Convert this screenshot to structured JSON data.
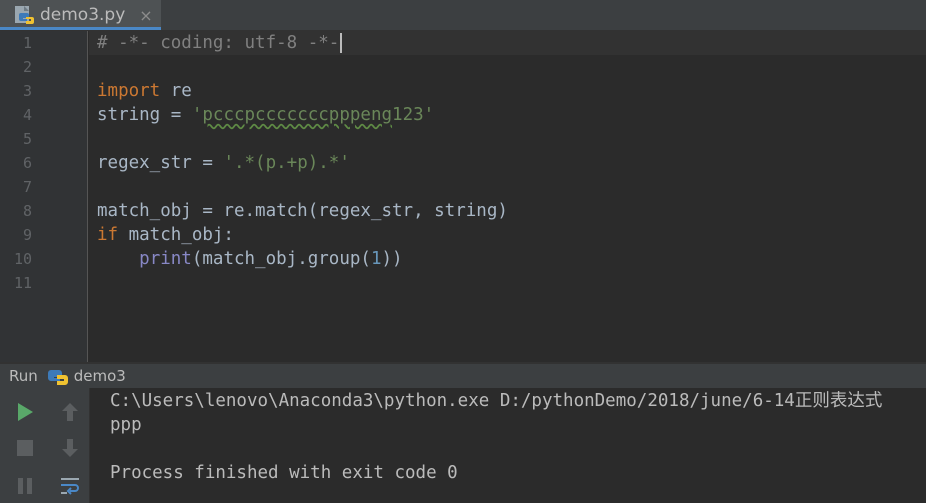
{
  "tab": {
    "filename": "demo3.py",
    "close_glyph": "×"
  },
  "editor": {
    "line_numbers": [
      "1",
      "2",
      "3",
      "4",
      "5",
      "6",
      "7",
      "8",
      "9",
      "10",
      "11"
    ],
    "l1_comment": "# -*- coding: utf-8 -*-",
    "l3_kw": "import",
    "l3_mod": " re",
    "l4_var": "string = ",
    "l4_q1": "'",
    "l4_strsquig": "pcccpcccccccpppeng",
    "l4_strrest": "123'",
    "l6_var": "regex_str = ",
    "l6_str": "'.*(p.+p).*'",
    "l8_code": "match_obj = re.match(regex_str, string)",
    "l9_kw": "if",
    "l9_rest": " match_obj:",
    "l10_indent": "    ",
    "l10_builtin": "print",
    "l10_mid": "(match_obj.group(",
    "l10_num": "1",
    "l10_end": "))"
  },
  "run": {
    "label": "Run",
    "config": "demo3"
  },
  "console": {
    "cmd": "C:\\Users\\lenovo\\Anaconda3\\python.exe D:/pythonDemo/2018/june/6-14正则表达式",
    "output": "ppp",
    "exit": "Process finished with exit code 0"
  },
  "colors": {
    "background": "#2b2b2b",
    "keyword": "#cc7832",
    "string": "#6a8759",
    "number": "#6897bb",
    "comment": "#808080",
    "builtin": "#8888c6",
    "run_green": "#59a869"
  }
}
